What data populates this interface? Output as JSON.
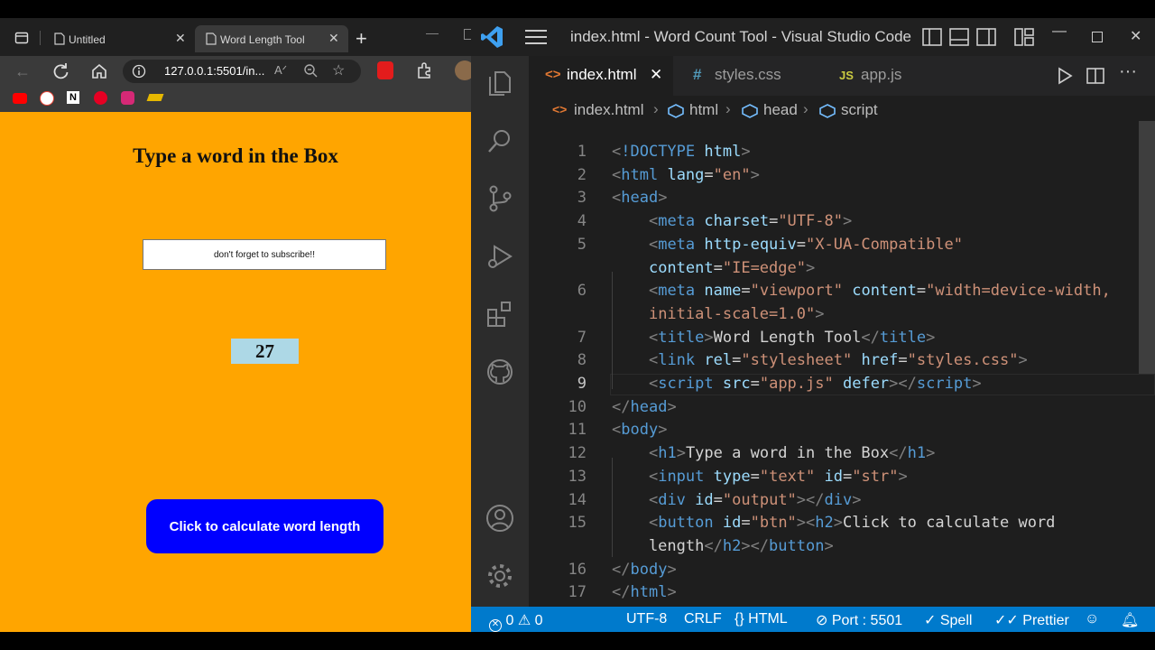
{
  "browser": {
    "tabs": [
      {
        "label": "Untitled",
        "active": false
      },
      {
        "label": "Word Length Tool",
        "active": true
      }
    ],
    "url": "127.0.0.1:5501/in...",
    "bookmarks": [
      "youtube-icon",
      "google-icon",
      "notion-icon",
      "pinterest-icon",
      "instagram-icon",
      "extension-icon"
    ],
    "page": {
      "heading": "Type a word in the Box",
      "input_value": "don't forget to subscribe!!",
      "output": "27",
      "button_label": "Click to calculate word length",
      "colors": {
        "background": "#ffa500",
        "output_bg": "#add8e6",
        "button_bg": "#0000ff"
      }
    }
  },
  "vscode": {
    "title": "index.html - Word Count Tool - Visual Studio Code",
    "tabs": [
      {
        "label": "index.html",
        "icon": "html-icon",
        "active": true
      },
      {
        "label": "styles.css",
        "icon": "css-icon",
        "active": false
      },
      {
        "label": "app.js",
        "icon": "js-icon",
        "active": false
      }
    ],
    "breadcrumb": [
      "index.html",
      "html",
      "head",
      "script"
    ],
    "code": {
      "line_numbers": [
        "1",
        "2",
        "3",
        "4",
        "5",
        "",
        "6",
        "",
        "7",
        "8",
        "9",
        "10",
        "11",
        "12",
        "13",
        "14",
        "15",
        "",
        "16",
        "17"
      ],
      "lines": [
        [
          {
            "c": "b",
            "t": "<"
          },
          {
            "c": "t",
            "t": "!DOCTYPE"
          },
          {
            "c": "x",
            "t": " "
          },
          {
            "c": "a",
            "t": "html"
          },
          {
            "c": "b",
            "t": ">"
          }
        ],
        [
          {
            "c": "b",
            "t": "<"
          },
          {
            "c": "t",
            "t": "html"
          },
          {
            "c": "x",
            "t": " "
          },
          {
            "c": "a",
            "t": "lang"
          },
          {
            "c": "x",
            "t": "="
          },
          {
            "c": "s",
            "t": "\"en\""
          },
          {
            "c": "b",
            "t": ">"
          }
        ],
        [
          {
            "c": "b",
            "t": "<"
          },
          {
            "c": "t",
            "t": "head"
          },
          {
            "c": "b",
            "t": ">"
          }
        ],
        [
          {
            "c": "x",
            "t": "    "
          },
          {
            "c": "b",
            "t": "<"
          },
          {
            "c": "t",
            "t": "meta"
          },
          {
            "c": "x",
            "t": " "
          },
          {
            "c": "a",
            "t": "charset"
          },
          {
            "c": "x",
            "t": "="
          },
          {
            "c": "s",
            "t": "\"UTF-8\""
          },
          {
            "c": "b",
            "t": ">"
          }
        ],
        [
          {
            "c": "x",
            "t": "    "
          },
          {
            "c": "b",
            "t": "<"
          },
          {
            "c": "t",
            "t": "meta"
          },
          {
            "c": "x",
            "t": " "
          },
          {
            "c": "a",
            "t": "http-equiv"
          },
          {
            "c": "x",
            "t": "="
          },
          {
            "c": "s",
            "t": "\"X-UA-Compatible\""
          }
        ],
        [
          {
            "c": "x",
            "t": "    "
          },
          {
            "c": "a",
            "t": "content"
          },
          {
            "c": "x",
            "t": "="
          },
          {
            "c": "s",
            "t": "\"IE=edge\""
          },
          {
            "c": "b",
            "t": ">"
          }
        ],
        [
          {
            "c": "x",
            "t": "    "
          },
          {
            "c": "b",
            "t": "<"
          },
          {
            "c": "t",
            "t": "meta"
          },
          {
            "c": "x",
            "t": " "
          },
          {
            "c": "a",
            "t": "name"
          },
          {
            "c": "x",
            "t": "="
          },
          {
            "c": "s",
            "t": "\"viewport\""
          },
          {
            "c": "x",
            "t": " "
          },
          {
            "c": "a",
            "t": "content"
          },
          {
            "c": "x",
            "t": "="
          },
          {
            "c": "s",
            "t": "\"width=device-width,"
          }
        ],
        [
          {
            "c": "x",
            "t": "    "
          },
          {
            "c": "s",
            "t": "initial-scale=1.0\""
          },
          {
            "c": "b",
            "t": ">"
          }
        ],
        [
          {
            "c": "x",
            "t": "    "
          },
          {
            "c": "b",
            "t": "<"
          },
          {
            "c": "t",
            "t": "title"
          },
          {
            "c": "b",
            "t": ">"
          },
          {
            "c": "x",
            "t": "Word Length Tool"
          },
          {
            "c": "b",
            "t": "</"
          },
          {
            "c": "t",
            "t": "title"
          },
          {
            "c": "b",
            "t": ">"
          }
        ],
        [
          {
            "c": "x",
            "t": "    "
          },
          {
            "c": "b",
            "t": "<"
          },
          {
            "c": "t",
            "t": "link"
          },
          {
            "c": "x",
            "t": " "
          },
          {
            "c": "a",
            "t": "rel"
          },
          {
            "c": "x",
            "t": "="
          },
          {
            "c": "s",
            "t": "\"stylesheet\""
          },
          {
            "c": "x",
            "t": " "
          },
          {
            "c": "a",
            "t": "href"
          },
          {
            "c": "x",
            "t": "="
          },
          {
            "c": "s",
            "t": "\"styles.css\""
          },
          {
            "c": "b",
            "t": ">"
          }
        ],
        [
          {
            "c": "x",
            "t": "    "
          },
          {
            "c": "b",
            "t": "<"
          },
          {
            "c": "t",
            "t": "script"
          },
          {
            "c": "x",
            "t": " "
          },
          {
            "c": "a",
            "t": "src"
          },
          {
            "c": "x",
            "t": "="
          },
          {
            "c": "s",
            "t": "\"app.js\""
          },
          {
            "c": "x",
            "t": " "
          },
          {
            "c": "a",
            "t": "defer"
          },
          {
            "c": "b",
            "t": "></"
          },
          {
            "c": "t",
            "t": "script"
          },
          {
            "c": "b",
            "t": ">"
          }
        ],
        [
          {
            "c": "b",
            "t": "</"
          },
          {
            "c": "t",
            "t": "head"
          },
          {
            "c": "b",
            "t": ">"
          }
        ],
        [
          {
            "c": "b",
            "t": "<"
          },
          {
            "c": "t",
            "t": "body"
          },
          {
            "c": "b",
            "t": ">"
          }
        ],
        [
          {
            "c": "x",
            "t": "    "
          },
          {
            "c": "b",
            "t": "<"
          },
          {
            "c": "t",
            "t": "h1"
          },
          {
            "c": "b",
            "t": ">"
          },
          {
            "c": "x",
            "t": "Type a word in the Box"
          },
          {
            "c": "b",
            "t": "</"
          },
          {
            "c": "t",
            "t": "h1"
          },
          {
            "c": "b",
            "t": ">"
          }
        ],
        [
          {
            "c": "x",
            "t": "    "
          },
          {
            "c": "b",
            "t": "<"
          },
          {
            "c": "t",
            "t": "input"
          },
          {
            "c": "x",
            "t": " "
          },
          {
            "c": "a",
            "t": "type"
          },
          {
            "c": "x",
            "t": "="
          },
          {
            "c": "s",
            "t": "\"text\""
          },
          {
            "c": "x",
            "t": " "
          },
          {
            "c": "a",
            "t": "id"
          },
          {
            "c": "x",
            "t": "="
          },
          {
            "c": "s",
            "t": "\"str\""
          },
          {
            "c": "b",
            "t": ">"
          }
        ],
        [
          {
            "c": "x",
            "t": "    "
          },
          {
            "c": "b",
            "t": "<"
          },
          {
            "c": "t",
            "t": "div"
          },
          {
            "c": "x",
            "t": " "
          },
          {
            "c": "a",
            "t": "id"
          },
          {
            "c": "x",
            "t": "="
          },
          {
            "c": "s",
            "t": "\"output\""
          },
          {
            "c": "b",
            "t": "></"
          },
          {
            "c": "t",
            "t": "div"
          },
          {
            "c": "b",
            "t": ">"
          }
        ],
        [
          {
            "c": "x",
            "t": "    "
          },
          {
            "c": "b",
            "t": "<"
          },
          {
            "c": "t",
            "t": "button"
          },
          {
            "c": "x",
            "t": " "
          },
          {
            "c": "a",
            "t": "id"
          },
          {
            "c": "x",
            "t": "="
          },
          {
            "c": "s",
            "t": "\"btn\""
          },
          {
            "c": "b",
            "t": "><"
          },
          {
            "c": "t",
            "t": "h2"
          },
          {
            "c": "b",
            "t": ">"
          },
          {
            "c": "x",
            "t": "Click to calculate word"
          }
        ],
        [
          {
            "c": "x",
            "t": "    length"
          },
          {
            "c": "b",
            "t": "</"
          },
          {
            "c": "t",
            "t": "h2"
          },
          {
            "c": "b",
            "t": "></"
          },
          {
            "c": "t",
            "t": "button"
          },
          {
            "c": "b",
            "t": ">"
          }
        ],
        [
          {
            "c": "b",
            "t": "</"
          },
          {
            "c": "t",
            "t": "body"
          },
          {
            "c": "b",
            "t": ">"
          }
        ],
        [
          {
            "c": "b",
            "t": "</"
          },
          {
            "c": "t",
            "t": "html"
          },
          {
            "c": "b",
            "t": ">"
          }
        ]
      ]
    },
    "status": {
      "errors": "0",
      "warnings": "0",
      "encoding": "UTF-8",
      "eol": "CRLF",
      "language": "HTML",
      "port": "Port : 5501",
      "spell": "Spell",
      "prettier": "Prettier"
    },
    "colors": {
      "statusbar": "#007acc",
      "editor_bg": "#1e1e1e",
      "tag": "#569cd6",
      "attr": "#9cdcfe",
      "string": "#ce9178"
    }
  }
}
